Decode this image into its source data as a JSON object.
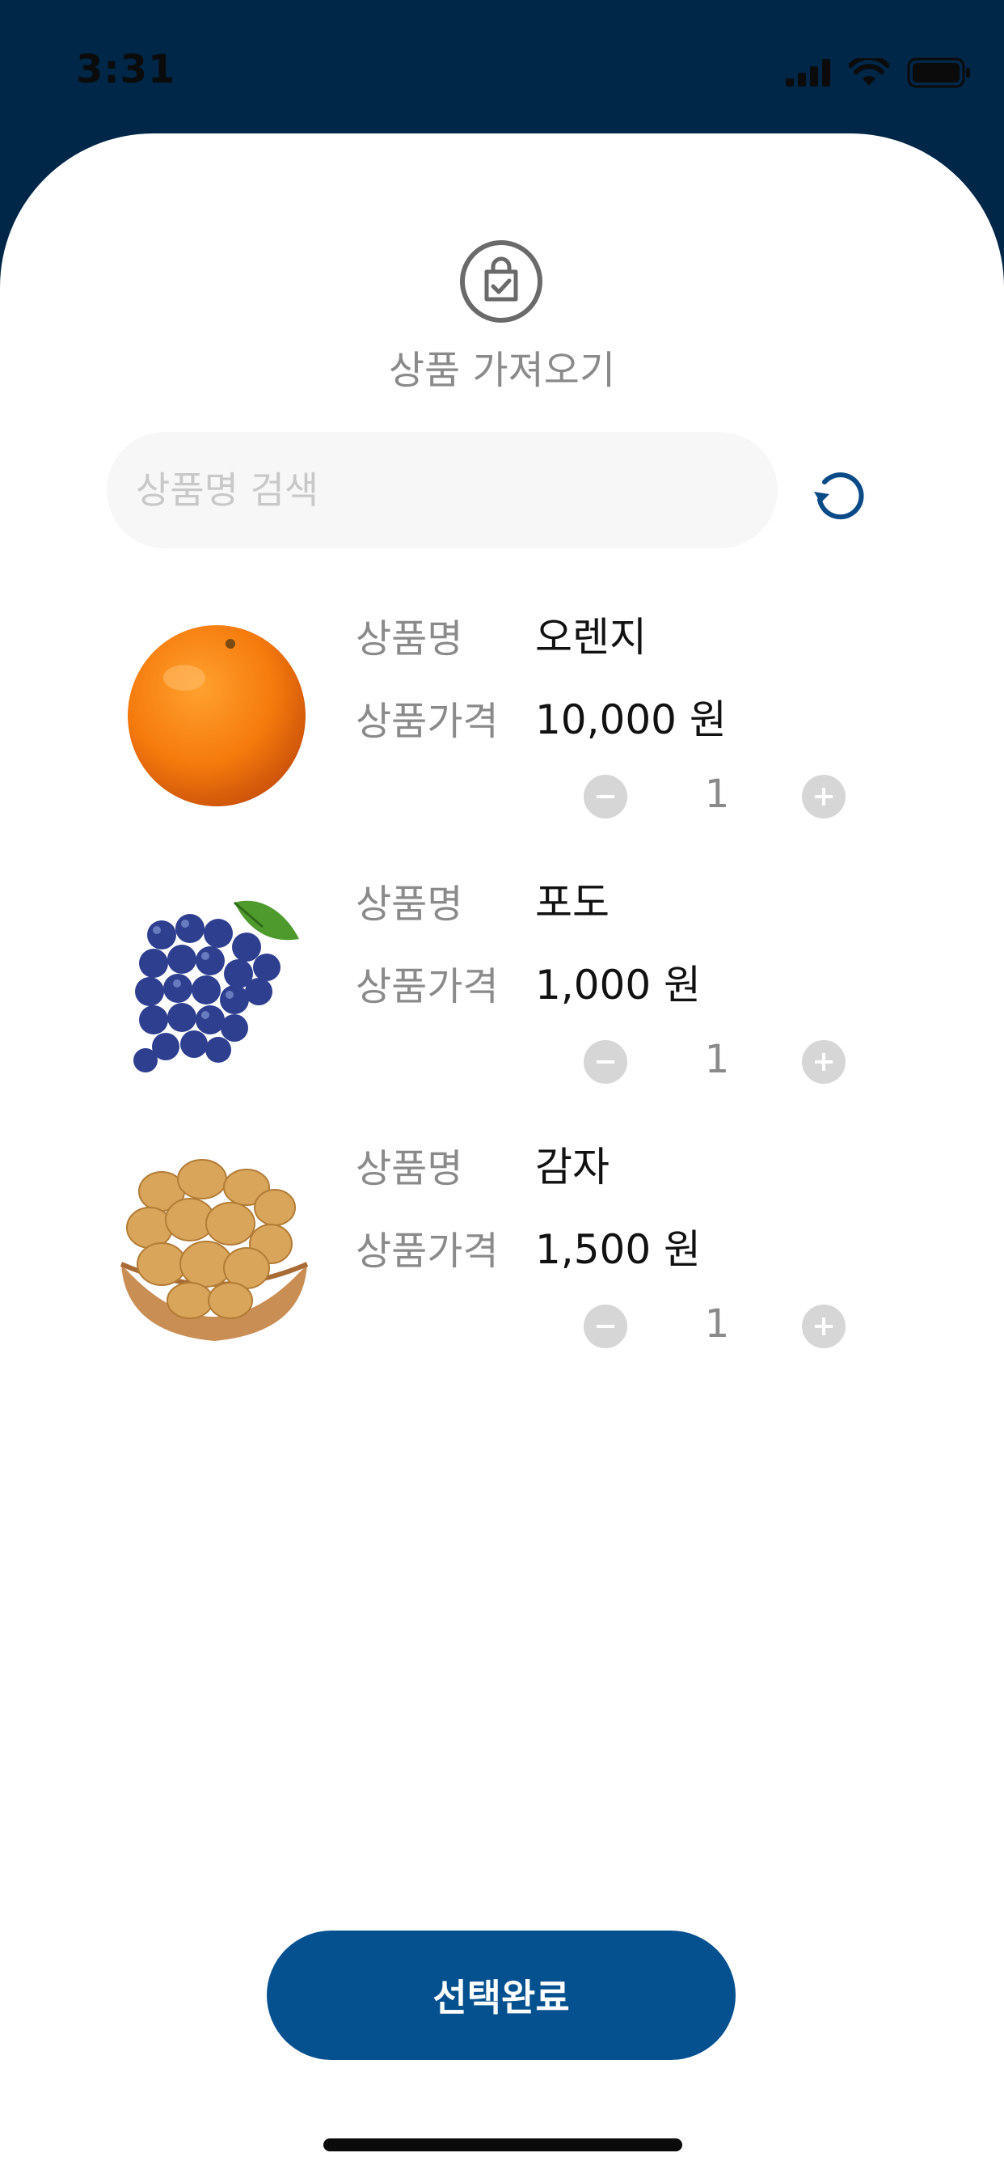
{
  "status_bar": {
    "time": "3:31",
    "signal_icon": "signal-bars-icon",
    "wifi_icon": "wifi-icon",
    "battery_icon": "battery-icon"
  },
  "header": {
    "icon": "shopping-bag-check-icon",
    "title": "상품 가져오기"
  },
  "search": {
    "placeholder": "상품명 검색",
    "value": "",
    "refresh_icon": "refresh-icon"
  },
  "products": [
    {
      "image": "orange",
      "name_label": "상품명",
      "name": "오렌지",
      "price_label": "상품가격",
      "price": "10,000 원",
      "quantity": "1"
    },
    {
      "image": "grapes",
      "name_label": "상품명",
      "name": "포도",
      "price_label": "상품가격",
      "price": "1,000 원",
      "quantity": "1"
    },
    {
      "image": "potatoes",
      "name_label": "상품명",
      "name": "감자",
      "price_label": "상품가격",
      "price": "1,500 원",
      "quantity": "1"
    }
  ],
  "footer": {
    "submit_label": "선택완료"
  },
  "colors": {
    "header_bg": "#002748",
    "accent": "#05518f",
    "stepper": "#d6d6d6",
    "label": "#8a8a8a"
  }
}
